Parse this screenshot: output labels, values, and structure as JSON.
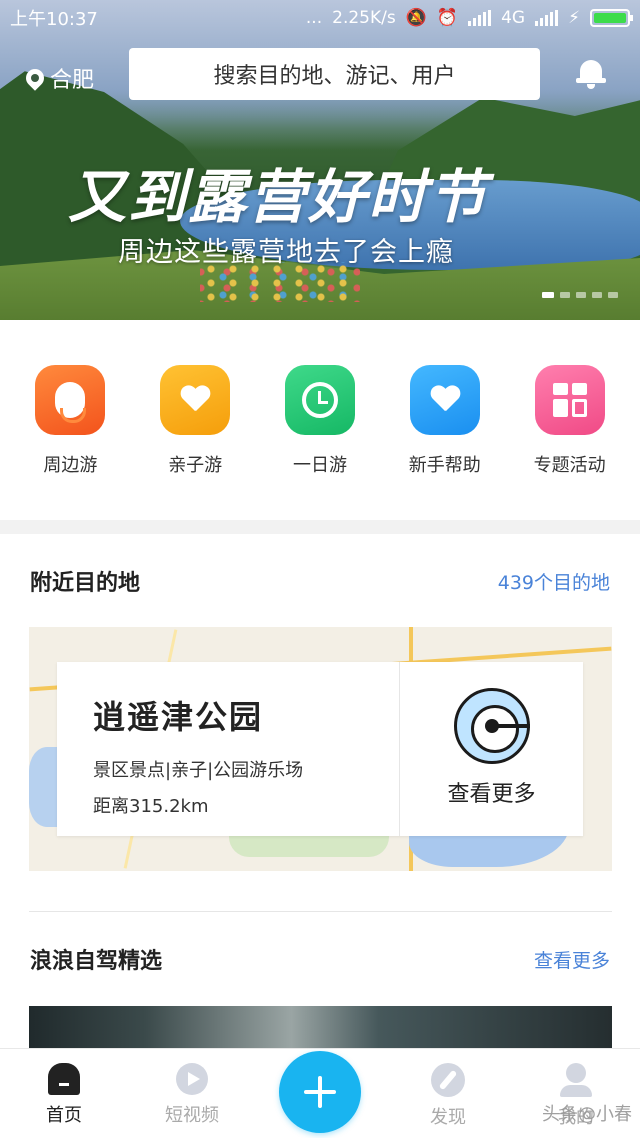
{
  "status_bar": {
    "time": "上午10:37",
    "dots": "...",
    "net_speed": "2.25K/s",
    "network": "4G"
  },
  "header": {
    "city": "合肥",
    "search_placeholder": "搜索目的地、游记、用户"
  },
  "banner": {
    "title": "又到露营好时节",
    "subtitle": "周边这些露营地去了会上瘾",
    "page_count": 5,
    "active_index": 0
  },
  "categories": [
    {
      "label": "周边游",
      "icon": "location-person-icon",
      "color": "#f3531c"
    },
    {
      "label": "亲子游",
      "icon": "heart-icon",
      "color": "#f59e0b"
    },
    {
      "label": "一日游",
      "icon": "clock-icon",
      "color": "#16b865"
    },
    {
      "label": "新手帮助",
      "icon": "heart-icon",
      "color": "#1a8ff0"
    },
    {
      "label": "专题活动",
      "icon": "grid-icon",
      "color": "#f04a86"
    }
  ],
  "nearby": {
    "title": "附近目的地",
    "link": "439个目的地",
    "place": {
      "name": "逍遥津公园",
      "tags": "景区景点|亲子|公园游乐场",
      "distance": "距离315.2km",
      "more": "查看更多"
    }
  },
  "selfdrive": {
    "title": "浪浪自驾精选",
    "link": "查看更多"
  },
  "tabbar": {
    "home": "首页",
    "video": "短视频",
    "discover": "发现",
    "me": "我的"
  },
  "watermark": "头条@小春"
}
